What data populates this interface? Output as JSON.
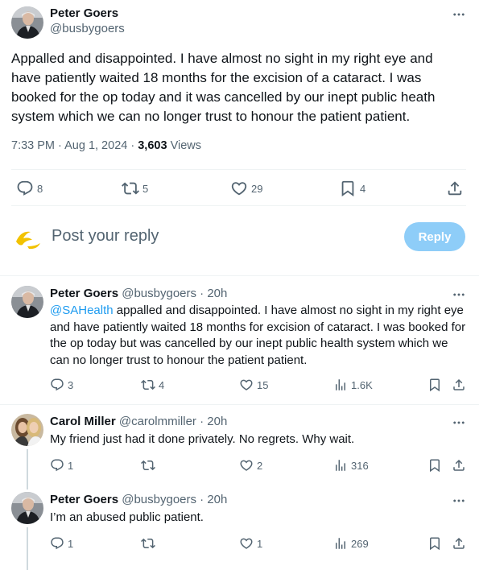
{
  "main_tweet": {
    "author_name": "Peter Goers",
    "author_handle": "@busbygoers",
    "text": "Appalled and disappointed. I have almost no sight in my right eye and have patiently waited 18 months for the excision of a cataract. I was booked for the op today and it was cancelled by our inept public heath system which we can no longer trust to honour the patient patient.",
    "time": "7:33 PM",
    "date": "Aug 1, 2024",
    "separator": "·",
    "views_count": "3,603",
    "views_label": "Views",
    "replies": "8",
    "retweets": "5",
    "likes": "29",
    "bookmarks": "4"
  },
  "composer": {
    "placeholder": "Post your reply",
    "reply_button": "Reply"
  },
  "replies": [
    {
      "author_name": "Peter Goers",
      "author_handle": "@busbygoers",
      "age": "· 20h",
      "mention": "@SAHealth",
      "text": " appalled and disappointed. I have almost no sight in my right eye and have patiently waited 18 months for excision of cataract. I was booked for the op today but was cancelled by our inept public health system which we can no longer trust to honour the patient patient.",
      "replies": "3",
      "retweets": "4",
      "likes": "15",
      "views": "1.6K"
    },
    {
      "author_name": "Carol Miller",
      "author_handle": "@carolmmiller",
      "age": "· 20h",
      "text": "My friend just had it done privately. No regrets. Why wait.",
      "replies": "1",
      "retweets": "",
      "likes": "2",
      "views": "316"
    },
    {
      "author_name": "Peter Goers",
      "author_handle": "@busbygoers",
      "age": "· 20h",
      "text": "I’m an abused public patient.",
      "replies": "1",
      "retweets": "",
      "likes": "1",
      "views": "269"
    }
  ],
  "colors": {
    "accent": "#1d9bf0",
    "reply_button_disabled": "#8ecdf8",
    "secondary_text": "#536471",
    "primary_text": "#0f1419",
    "divider": "#eff3f4"
  },
  "icons": [
    "more-icon",
    "reply-icon",
    "retweet-icon",
    "like-icon",
    "bookmark-icon",
    "share-icon",
    "views-icon",
    "composer-avatar-logo"
  ]
}
